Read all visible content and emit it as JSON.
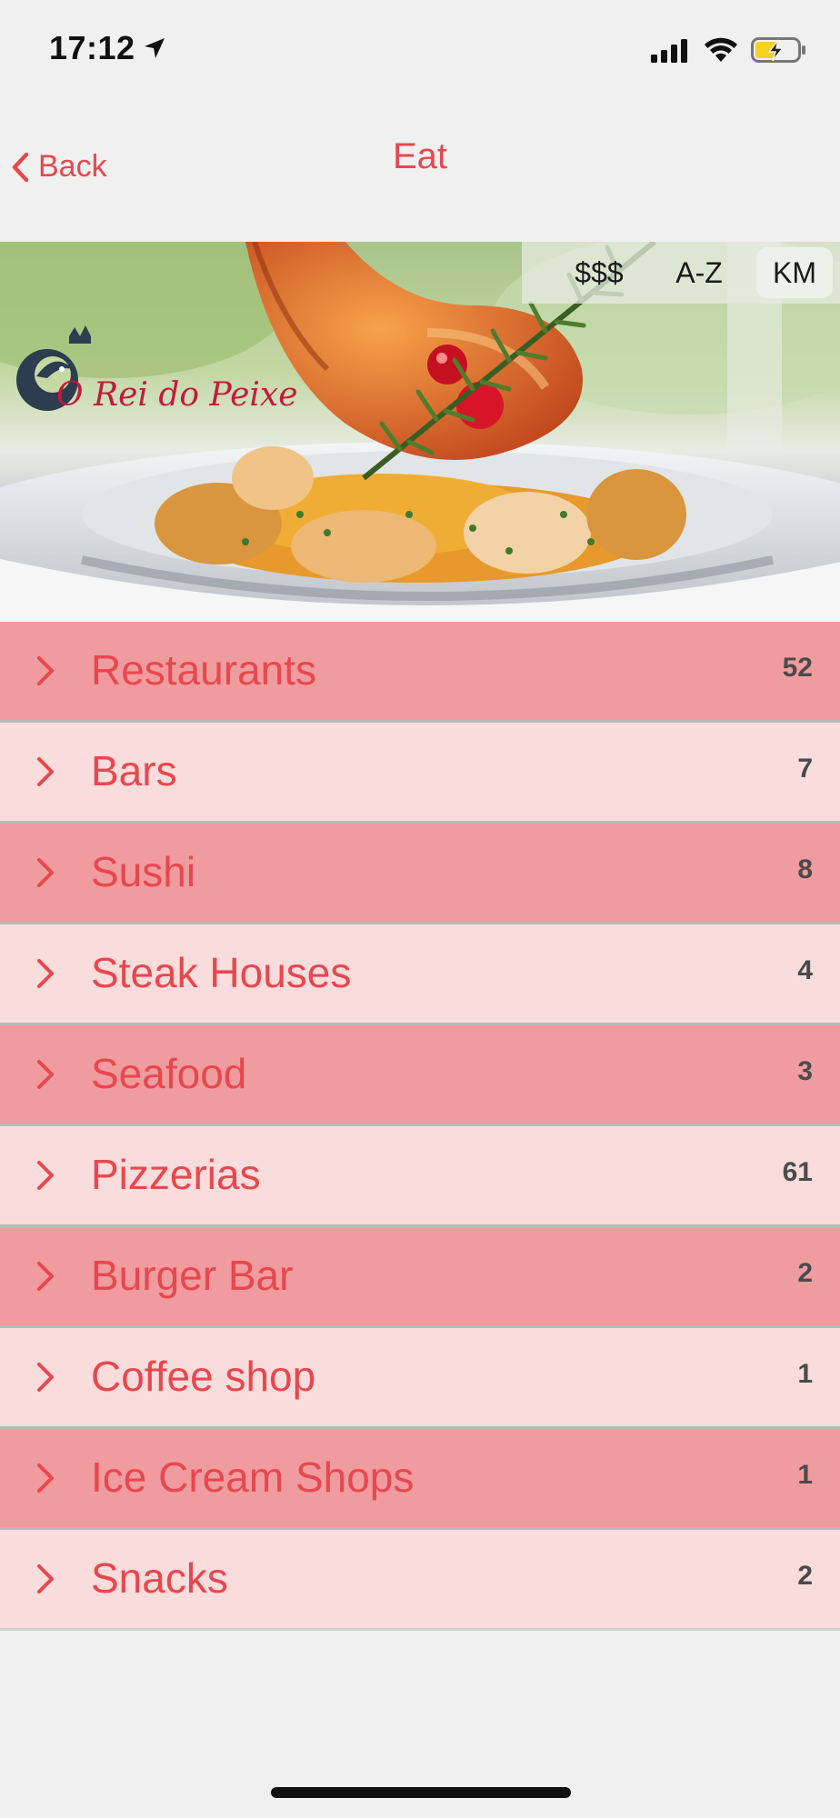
{
  "status_bar": {
    "time": "17:12",
    "location_icon": "location-arrow-icon",
    "signal_icon": "cellular-signal-icon",
    "wifi_icon": "wifi-icon",
    "battery_icon": "battery-charging-icon"
  },
  "nav": {
    "back_label": "Back",
    "title": "Eat"
  },
  "hero": {
    "logo_text": "O Rei do Peixe",
    "sort_options": [
      "$$$",
      "A-Z",
      "KM"
    ],
    "active_sort": "KM"
  },
  "categories": [
    {
      "label": "Restaurants",
      "count": "52"
    },
    {
      "label": "Bars",
      "count": "7"
    },
    {
      "label": "Sushi",
      "count": "8"
    },
    {
      "label": "Steak Houses",
      "count": "4"
    },
    {
      "label": "Seafood",
      "count": "3"
    },
    {
      "label": "Pizzerias",
      "count": "61"
    },
    {
      "label": "Burger Bar",
      "count": "2"
    },
    {
      "label": "Coffee shop",
      "count": "1"
    },
    {
      "label": "Ice Cream Shops",
      "count": "1"
    },
    {
      "label": "Snacks",
      "count": "2"
    }
  ],
  "colors": {
    "accent": "#e8474f",
    "row_dark": "#f09c9e",
    "row_light": "#f9dcdc",
    "background": "#f0f0f0"
  }
}
